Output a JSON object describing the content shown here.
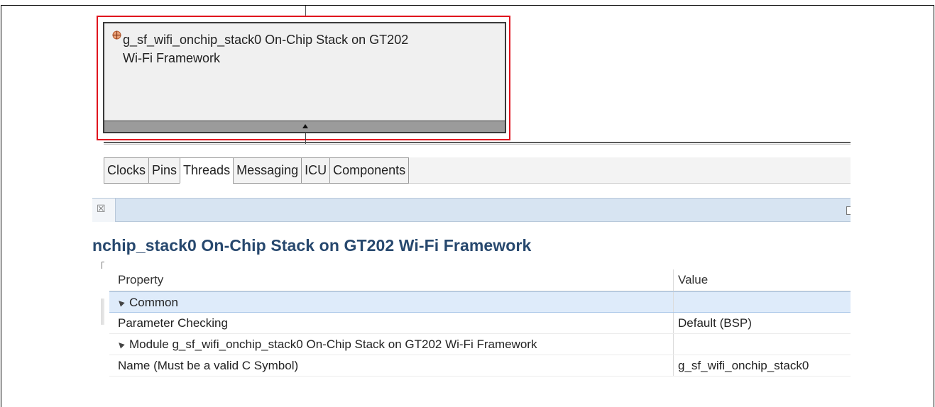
{
  "module": {
    "line1": "g_sf_wifi_onchip_stack0 On-Chip Stack on GT202",
    "line2": "Wi-Fi Framework"
  },
  "tabs": [
    {
      "label": "Clocks"
    },
    {
      "label": "Pins"
    },
    {
      "label": "Threads",
      "active": true
    },
    {
      "label": "Messaging"
    },
    {
      "label": "ICU"
    },
    {
      "label": "Components"
    }
  ],
  "view": {
    "close_glyph": "☒"
  },
  "properties": {
    "title": "nchip_stack0 On-Chip Stack on GT202 Wi-Fi Framework",
    "columns": {
      "property": "Property",
      "value": "Value"
    },
    "rows": [
      {
        "property": "Common",
        "value": "",
        "group": true
      },
      {
        "property": "Parameter Checking",
        "value": "Default (BSP)"
      },
      {
        "property": "Module g_sf_wifi_onchip_stack0 On-Chip Stack on GT202 Wi-Fi Framework",
        "value": "",
        "group": true
      },
      {
        "property": "Name (Must be a valid C Symbol)",
        "value": "g_sf_wifi_onchip_stack0"
      }
    ]
  },
  "colors": {
    "highlight": "#e0141e",
    "title": "#27486e",
    "selection": "#deebfa"
  }
}
